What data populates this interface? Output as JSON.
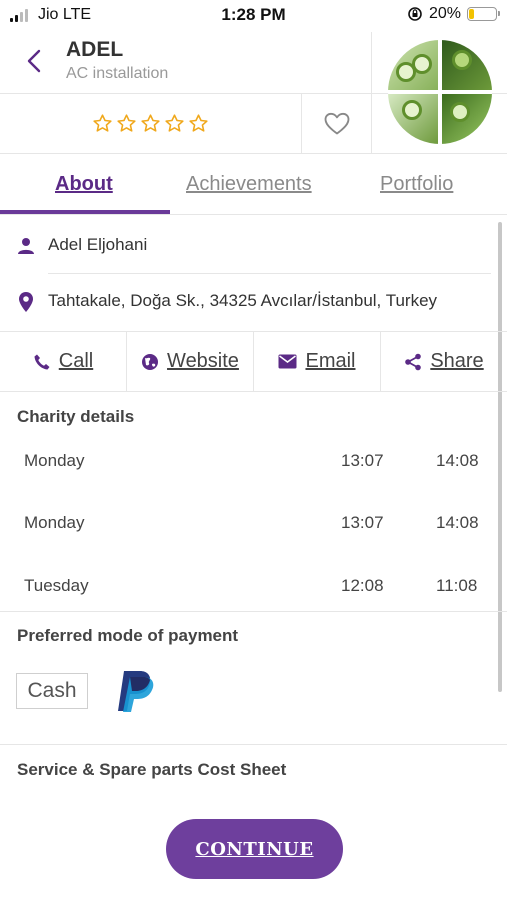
{
  "status_bar": {
    "carrier": "Jio  LTE",
    "time": "1:28 PM",
    "battery": "20%"
  },
  "header": {
    "name": "ADEL",
    "service": "AC installation"
  },
  "rating": {
    "stars_filled": 0,
    "stars_total": 5
  },
  "tabs": [
    {
      "label": "About",
      "active": true
    },
    {
      "label": "Achievements",
      "active": false
    },
    {
      "label": "Portfolio",
      "active": false
    }
  ],
  "about": {
    "person_name": "Adel Eljohani",
    "address": "Tahtakale, Doğa Sk., 34325 Avcılar/İstanbul, Turkey"
  },
  "actions": {
    "call": "Call",
    "website": "Website",
    "email": "Email",
    "share": "Share"
  },
  "charity": {
    "title": "Charity details",
    "rows": [
      {
        "day": "Monday",
        "from": "13:07",
        "to": "14:08"
      },
      {
        "day": "Monday",
        "from": "13:07",
        "to": "14:08"
      },
      {
        "day": "Tuesday",
        "from": "12:08",
        "to": "11:08"
      }
    ]
  },
  "payment": {
    "title": "Preferred mode of payment",
    "cash_label": "Cash"
  },
  "cost_sheet": {
    "title": "Service & Spare parts Cost Sheet"
  },
  "continue_label": "CONTINUE",
  "colors": {
    "accent": "#6e3f9d",
    "tab_active": "#5b2a86",
    "star": "#f0a81c"
  }
}
